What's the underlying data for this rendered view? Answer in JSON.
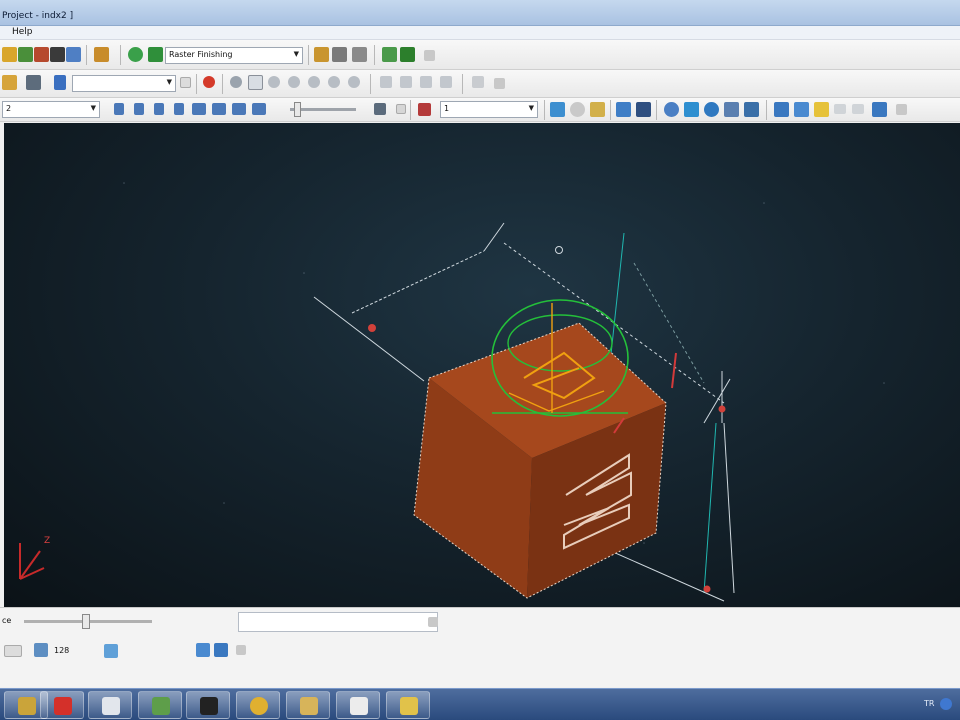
{
  "window": {
    "title": "Project - indx2 ]"
  },
  "menu": {
    "help": "Help"
  },
  "toolbar1": {
    "strategy_combo": "Raster Finishing"
  },
  "toolbar2": {
    "combo_value": ""
  },
  "toolbar3": {
    "left_combo": "2",
    "right_combo": "1"
  },
  "viewport": {
    "axis_label": "Z"
  },
  "bottom": {
    "left_label": "ce",
    "value": "128"
  },
  "tray": {
    "lang": "TR"
  },
  "colors": {
    "cube_front": "#8f3c17",
    "cube_top": "#a6481d",
    "cube_side": "#7a3213",
    "toolpath_green": "#24c03a",
    "toolpath_orange": "#f0a010",
    "viewport_bg": "#15242e",
    "taskbar": "#36598e"
  },
  "icons": [
    "toolpath-icon",
    "strategy-icon",
    "machine-icon",
    "simulate-icon",
    "view-icon",
    "workplane-icon",
    "measure-icon"
  ]
}
